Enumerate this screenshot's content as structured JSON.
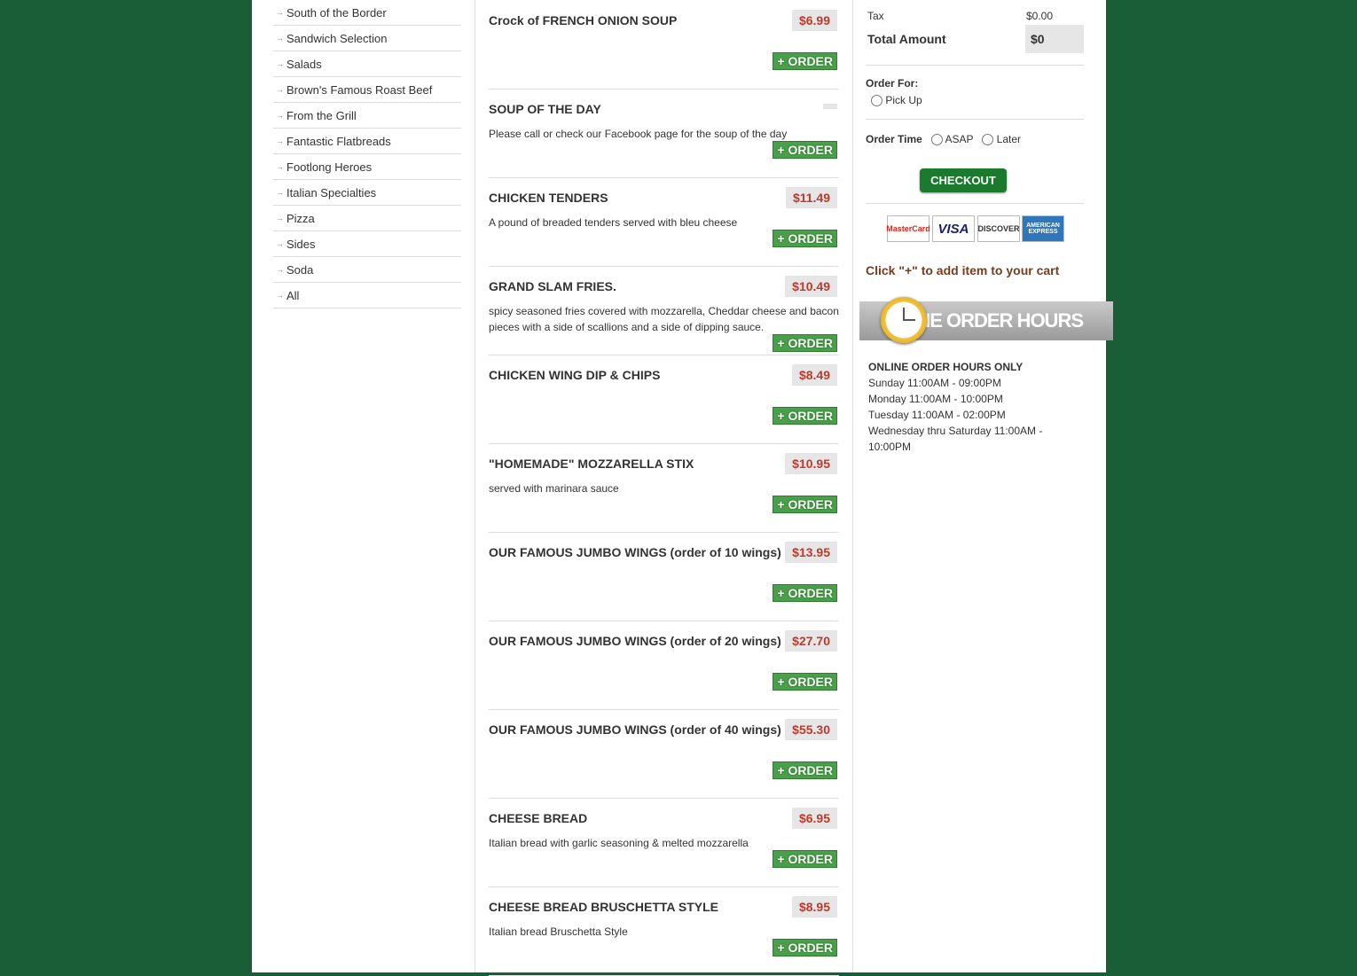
{
  "categories": [
    "South of the Border",
    "Sandwich Selection",
    "Salads",
    "Brown's Famous Roast Beef",
    "From the Grill",
    "Fantastic Flatbreads",
    "Footlong Heroes",
    "Italian Specialties",
    "Pizza",
    "Sides",
    "Soda",
    "All"
  ],
  "order_label": "+ ORDER",
  "items": [
    {
      "name": "Crock of FRENCH ONION SOUP",
      "price": "$6.99",
      "desc": ""
    },
    {
      "name": "SOUP OF THE DAY",
      "price": "",
      "desc": "Please call or check our Facebook page for the soup of the day"
    },
    {
      "name": "CHICKEN TENDERS",
      "price": "$11.49",
      "desc": "A pound of breaded tenders served with bleu cheese"
    },
    {
      "name": "GRAND SLAM FRIES.",
      "price": "$10.49",
      "desc": "spicy seasoned fries covered with mozzarella, Cheddar cheese and bacon pieces with a side of scallions and a side of dipping sauce."
    },
    {
      "name": "CHICKEN WING DIP & CHIPS",
      "price": "$8.49",
      "desc": ""
    },
    {
      "name": "\"HOMEMADE\" MOZZARELLA STIX",
      "price": "$10.95",
      "desc": "served with marinara sauce"
    },
    {
      "name": "OUR FAMOUS JUMBO WINGS (order of 10 wings)",
      "price": "$13.95",
      "desc": ""
    },
    {
      "name": "OUR FAMOUS JUMBO WINGS (order of 20 wings)",
      "price": "$27.70",
      "desc": ""
    },
    {
      "name": "OUR FAMOUS JUMBO WINGS (order of 40 wings)",
      "price": "$55.30",
      "desc": ""
    },
    {
      "name": "CHEESE BREAD",
      "price": "$6.95",
      "desc": "Italian bread with garlic seasoning & melted mozzarella"
    },
    {
      "name": "CHEESE BREAD BRUSCHETTA STYLE",
      "price": "$8.95",
      "desc": "Italian bread Bruschetta Style"
    }
  ],
  "cart": {
    "tax_label": "Tax",
    "tax_value": "$0.00",
    "total_label": "Total Amount",
    "total_value": "$0",
    "order_for_label": "Order For:",
    "pickup_label": "Pick Up",
    "order_time_label": "Order Time",
    "asap_label": "ASAP",
    "later_label": "Later",
    "checkout_label": "CHECKOUT",
    "cards": [
      "MasterCard",
      "VISA",
      "DISCOVER",
      "AMERICAN EXPRESS"
    ],
    "hint": "Click \"+\" to add item to your cart",
    "banner": "INE ORDER HOURS ONLY"
  },
  "hours": {
    "header": "ONLINE ORDER HOURS ONLY",
    "lines": [
      "Sunday 11:00AM - 09:00PM",
      "Monday 11:00AM - 10:00PM",
      "Tuesday 11:00AM - 02:00PM",
      "Wednesday thru Saturday 11:00AM - 10:00PM"
    ]
  },
  "colors": {
    "background": "#1a5e38",
    "price_text": "#c0392b",
    "order_button": "#4aa04a",
    "checkout_button": "#1b7a2e",
    "hint_text": "#7a3b1a"
  }
}
